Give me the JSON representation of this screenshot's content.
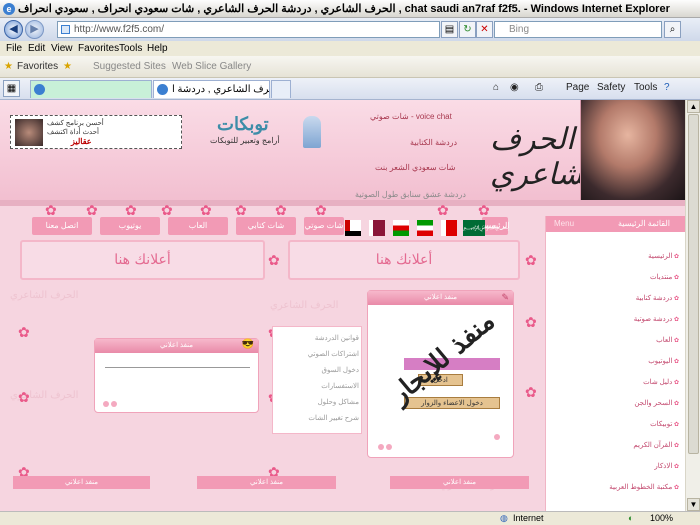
{
  "window": {
    "title": "الحرف الشاعري , دردشة الحرف الشاعري , شات سعودي انحراف , سعودي انحراف , chat saudi an7raf f2f5. - Windows Internet Explorer"
  },
  "address": {
    "url": "http://www.f2f5.com/",
    "search_placeholder": "Bing"
  },
  "menu": [
    "File",
    "Edit",
    "View",
    "Favorites",
    "Tools",
    "Help"
  ],
  "favorites": {
    "label": "Favorites",
    "suggested": "Suggested Sites",
    "slice": "Web Slice Gallery"
  },
  "tabs": [
    {
      "label": ""
    },
    {
      "label": "الحرف الشاعري , دردشة ا..."
    }
  ],
  "toolbar": {
    "page": "Page",
    "safety": "Safety",
    "tools": "Tools"
  },
  "status": {
    "zone": "Internet",
    "zoom": "100%"
  },
  "site": {
    "logo": "الحرف الشاعري",
    "header_links": [
      "شات صوتي - voice chat",
      "دردشة الكتابية",
      "شات سعودي الشعر بنت",
      "دردشة عشق سنابق طول الصوتية"
    ],
    "ad_top": {
      "line1": "أحسن برنامج كشف",
      "line2": "أحدث أداة اكتشف",
      "line3": "عقاليز"
    },
    "banner": {
      "title": "توبكات",
      "sub": "أرامج وتعبير للتوبكات"
    },
    "nav_tabs": [
      "اتصل معنا",
      "يوتيوب",
      "العاب",
      "شات كتابي",
      "شات صوتي",
      "الرئيسية"
    ],
    "ad_text": [
      "أعلانك هنا",
      "أعلانك هنا"
    ],
    "panel_title": "منفذ اعلاني",
    "enter_big": "منفذ للإيجار",
    "enter_btn": "ادخل",
    "member_btn": "دخول الاعضاء والزوار",
    "mid_links": [
      "قوانين الدردشة",
      "اشتراكات الصوتي",
      "دخول السوق",
      "الاستفسارات",
      "مشاكل وحلول",
      "شرح تغيير الشات"
    ],
    "sidebar": {
      "title": "القائمة الرئيسية",
      "en": "Menu",
      "items": [
        "الرئيسية",
        "منتديات",
        "دردشة كتابية",
        "دردشة صوتية",
        "العاب",
        "اليوتيوب",
        "دليل شات",
        "السحر والجن",
        "توبيكات",
        "القرآن الكريم",
        "الاذكار",
        "مكتبة الخطوط العربية"
      ]
    },
    "bottom_btns": [
      "منفذ اعلاني",
      "منفذ اعلاني",
      "منفذ اعلاني"
    ],
    "colors": {
      "pink": "#f29ab5",
      "bg": "#f6d5e0"
    }
  }
}
